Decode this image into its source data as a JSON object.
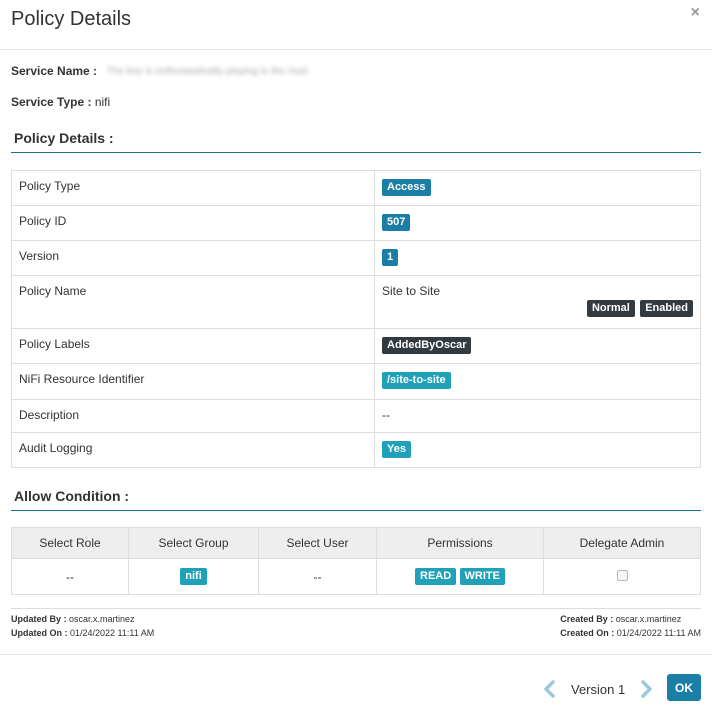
{
  "header": {
    "title": "Policy Details",
    "close_glyph": "×"
  },
  "service": {
    "name_label": "Service Name :",
    "name_value": "The boy is enthusiastically playing in the mud.",
    "type_label": "Service Type :",
    "type_value": "nifi"
  },
  "details": {
    "section_title": "Policy Details :",
    "rows": {
      "type": {
        "label": "Policy Type",
        "value": "Access"
      },
      "id": {
        "label": "Policy ID",
        "value": "507"
      },
      "version": {
        "label": "Version",
        "value": "1"
      },
      "name": {
        "label": "Policy Name",
        "value": "Site to Site",
        "badge_normal": "Normal",
        "badge_enabled": "Enabled"
      },
      "labels": {
        "label": "Policy Labels",
        "value": "AddedByOscar"
      },
      "resource": {
        "label": "NiFi Resource Identifier",
        "value": "/site-to-site"
      },
      "description": {
        "label": "Description",
        "value": "--"
      },
      "audit": {
        "label": "Audit Logging",
        "value": "Yes"
      }
    }
  },
  "allow": {
    "section_title": "Allow Condition :",
    "columns": [
      "Select Role",
      "Select Group",
      "Select User",
      "Permissions",
      "Delegate Admin"
    ],
    "row": {
      "role": "--",
      "group": "nifi",
      "user": "--",
      "perm_read": "READ",
      "perm_write": "WRITE",
      "delegate_admin": false
    }
  },
  "audit_info": {
    "updated_by_label": "Updated By :",
    "updated_by": "oscar.x.martinez",
    "updated_on_label": "Updated On :",
    "updated_on": "01/24/2022 11:11 AM",
    "created_by_label": "Created By :",
    "created_by": "oscar.x.martinez",
    "created_on_label": "Created On :",
    "created_on": "01/24/2022 11:11 AM"
  },
  "footer": {
    "version_text": "Version 1",
    "ok_label": "OK"
  },
  "colors": {
    "accent": "#1a7ea7",
    "teal": "#1fa1b8",
    "dark_badge": "#333a40",
    "chevron": "#9cc7dd"
  },
  "icons": {
    "close": "close-icon",
    "prev": "chevron-left-icon",
    "next": "chevron-right-icon"
  }
}
